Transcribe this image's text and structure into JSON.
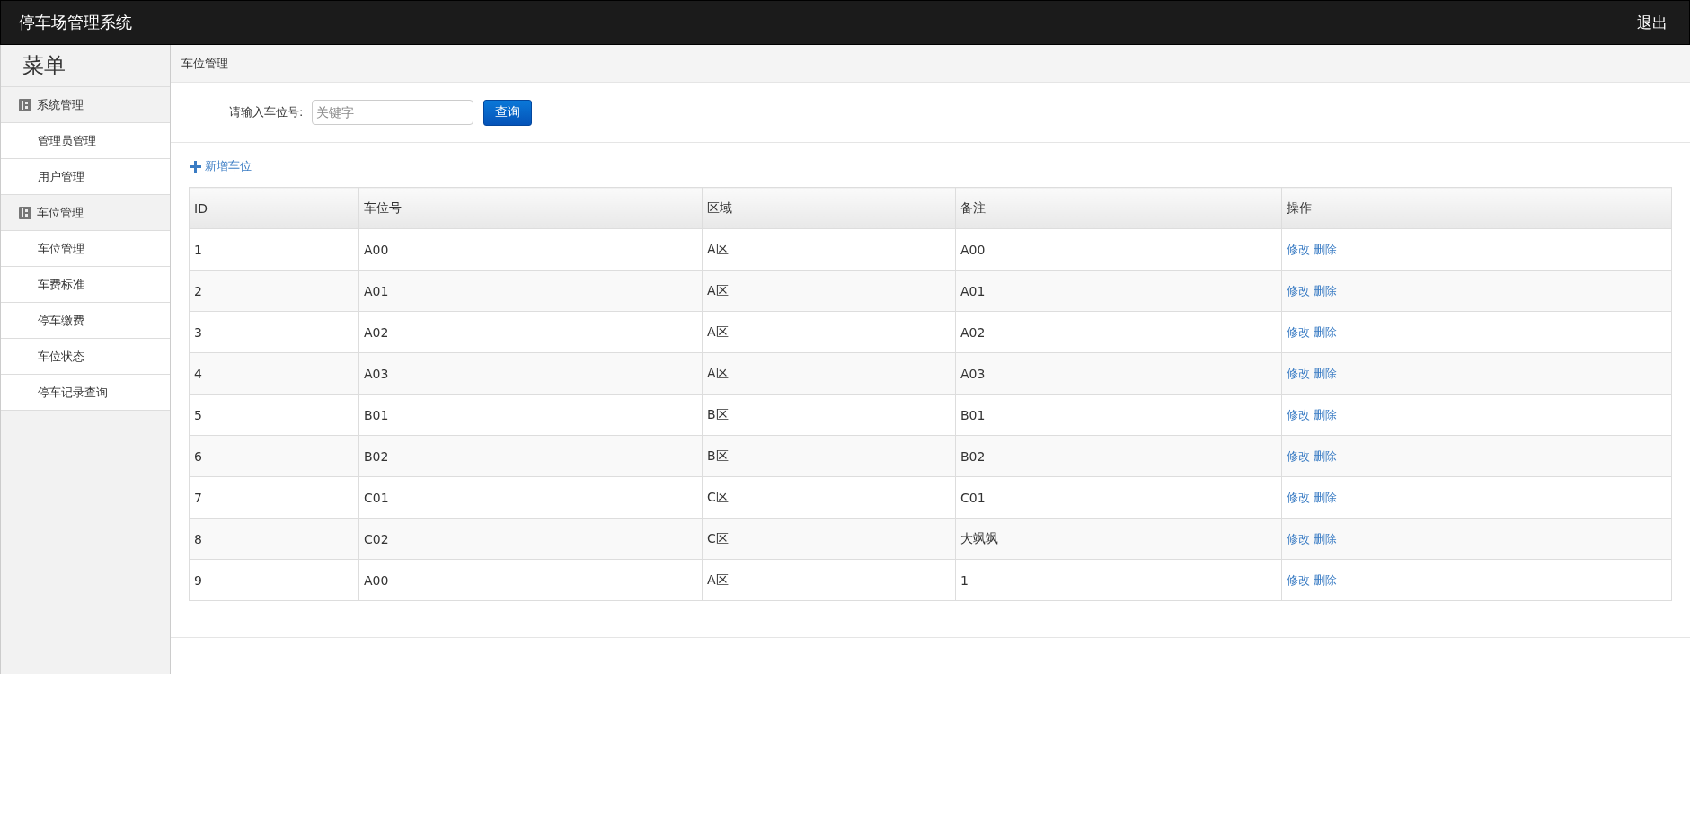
{
  "header": {
    "title": "停车场管理系统",
    "logout": "退出"
  },
  "sidebar": {
    "title": "菜单",
    "groups": [
      {
        "label": "系统管理",
        "items": [
          {
            "label": "管理员管理"
          },
          {
            "label": "用户管理"
          }
        ]
      },
      {
        "label": "车位管理",
        "items": [
          {
            "label": "车位管理"
          },
          {
            "label": "车费标准"
          },
          {
            "label": "停车缴费"
          },
          {
            "label": "车位状态"
          },
          {
            "label": "停车记录查询"
          }
        ]
      }
    ]
  },
  "breadcrumb": "车位管理",
  "search": {
    "label": "请输入车位号:",
    "placeholder": "关键字",
    "button": "查询"
  },
  "add_link": "新增车位",
  "table": {
    "columns": [
      "ID",
      "车位号",
      "区域",
      "备注",
      "操作"
    ],
    "rows": [
      {
        "cells": [
          "1",
          "A00",
          "A区",
          "A00"
        ],
        "actions": [
          "修改",
          "删除"
        ]
      },
      {
        "cells": [
          "2",
          "A01",
          "A区",
          "A01"
        ],
        "actions": [
          "修改",
          "删除"
        ]
      },
      {
        "cells": [
          "3",
          "A02",
          "A区",
          "A02"
        ],
        "actions": [
          "修改",
          "删除"
        ]
      },
      {
        "cells": [
          "4",
          "A03",
          "A区",
          "A03"
        ],
        "actions": [
          "修改",
          "删除"
        ]
      },
      {
        "cells": [
          "5",
          "B01",
          "B区",
          "B01"
        ],
        "actions": [
          "修改",
          "删除"
        ]
      },
      {
        "cells": [
          "6",
          "B02",
          "B区",
          "B02"
        ],
        "actions": [
          "修改",
          "删除"
        ]
      },
      {
        "cells": [
          "7",
          "C01",
          "C区",
          "C01"
        ],
        "actions": [
          "修改",
          "删除"
        ]
      },
      {
        "cells": [
          "8",
          "C02",
          "C区",
          "大飒飒"
        ],
        "actions": [
          "修改",
          "删除"
        ]
      },
      {
        "cells": [
          "9",
          "A00",
          "A区",
          "1"
        ],
        "actions": [
          "修改",
          "删除"
        ]
      }
    ]
  }
}
